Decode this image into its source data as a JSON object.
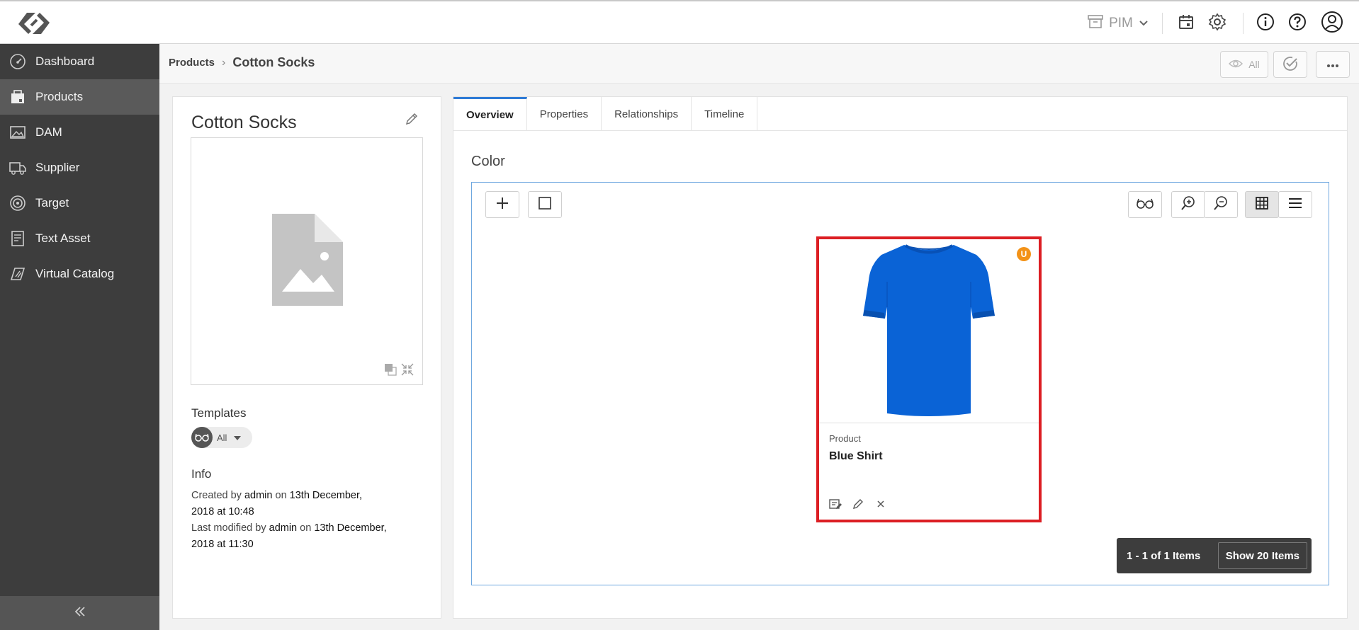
{
  "topbar": {
    "workspace_label": "PIM",
    "icons": [
      "calendar-icon",
      "gear-icon",
      "info-icon",
      "help-icon",
      "user-icon"
    ]
  },
  "sidebar": {
    "items": [
      {
        "label": "Dashboard",
        "icon": "dashboard-icon"
      },
      {
        "label": "Products",
        "icon": "products-icon",
        "active": true
      },
      {
        "label": "DAM",
        "icon": "dam-icon"
      },
      {
        "label": "Supplier",
        "icon": "truck-icon"
      },
      {
        "label": "Target",
        "icon": "target-icon"
      },
      {
        "label": "Text Asset",
        "icon": "text-asset-icon"
      },
      {
        "label": "Virtual Catalog",
        "icon": "catalog-icon"
      }
    ]
  },
  "header": {
    "breadcrumb_parent": "Products",
    "breadcrumb_separator": "›",
    "breadcrumb_current": "Cotton Socks",
    "filter_label": "All"
  },
  "left": {
    "title": "Cotton Socks",
    "templates_heading": "Templates",
    "template_value": "All",
    "info_heading": "Info",
    "created_prefix": "Created by",
    "created_user": "admin",
    "created_on": "on",
    "created_date": "13th December,",
    "created_year_at": "2018 at",
    "created_time": "10:48",
    "modified_prefix": "Last modified by",
    "modified_user": "admin",
    "modified_on": "on",
    "modified_date": "13th December,",
    "modified_year_at": "2018 at",
    "modified_time": "11:30"
  },
  "tabs": [
    "Overview",
    "Properties",
    "Relationships",
    "Timeline"
  ],
  "section": {
    "title": "Color",
    "item": {
      "badge": "U",
      "type": "Product",
      "name": "Blue Shirt"
    },
    "pager_count": "1 - 1 of 1 Items",
    "pager_show": "Show 20 Items"
  },
  "colors": {
    "accent": "#2e7bd6",
    "highlight": "#dc1e23",
    "badge": "#f39217",
    "sidebar": "#3d3d3d",
    "shirt": "#0a63d6"
  }
}
